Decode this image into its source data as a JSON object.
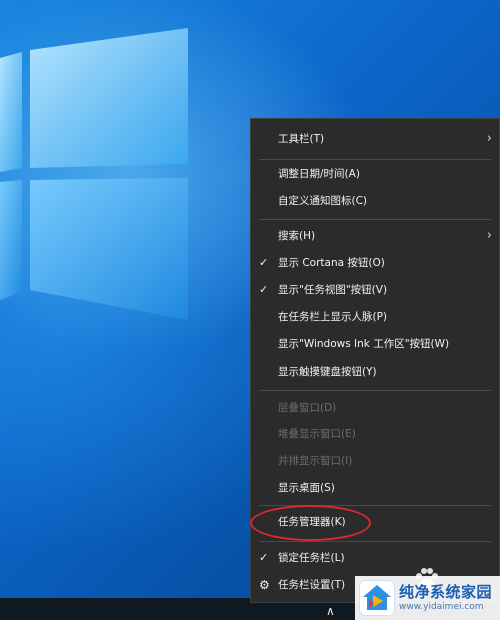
{
  "menu": {
    "items": [
      {
        "label": "工具栏(T)",
        "submenu": true
      },
      {
        "label": "调整日期/时间(A)"
      },
      {
        "label": "自定义通知图标(C)"
      },
      {
        "label": "搜索(H)",
        "submenu": true
      },
      {
        "label": "显示 Cortana 按钮(O)",
        "checked": true
      },
      {
        "label": "显示\"任务视图\"按钮(V)",
        "checked": true
      },
      {
        "label": "在任务栏上显示人脉(P)"
      },
      {
        "label": "显示\"Windows Ink 工作区\"按钮(W)"
      },
      {
        "label": "显示触摸键盘按钮(Y)"
      },
      {
        "label": "层叠窗口(D)",
        "disabled": true
      },
      {
        "label": "堆叠显示窗口(E)",
        "disabled": true
      },
      {
        "label": "并排显示窗口(I)",
        "disabled": true
      },
      {
        "label": "显示桌面(S)"
      },
      {
        "label": "任务管理器(K)",
        "highlighted": true
      },
      {
        "label": "锁定任务栏(L)",
        "checked": true
      },
      {
        "label": "任务栏设置(T)",
        "icon": "gear-icon"
      }
    ]
  },
  "icons": {
    "check": "✓",
    "submenu_arrow": "›",
    "gear": "⚙",
    "tray_arrow": "∧"
  },
  "watermark": {
    "title": "纯净系统家园",
    "url": "www.yidaimei.com"
  },
  "colors": {
    "menu_bg": "#2b2b2b",
    "menu_text": "#f2f2f2",
    "disabled_text": "#6d6d6d",
    "highlight": "#d9292c"
  }
}
